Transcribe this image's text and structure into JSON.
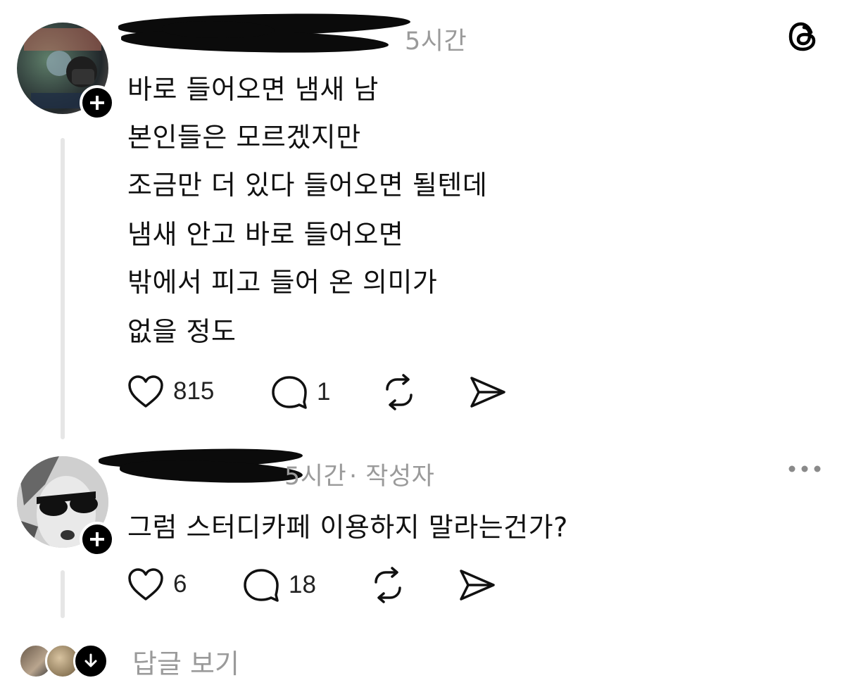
{
  "post": {
    "username": "",
    "time": "5시간",
    "body_lines": [
      "바로 들어오면 냄새 남",
      "본인들은 모르겠지만",
      "조금만 더 있다 들어오면 될텐데",
      "냄새 안고 바로 들어오면",
      "밖에서 피고 들어 온 의미가",
      "없을 정도"
    ],
    "likes": "815",
    "replies": "1"
  },
  "reply": {
    "username": "",
    "time": "5시간",
    "meta_suffix": "· 작성자",
    "text": "그럼 스터디카페 이용하지 말라는건가?",
    "likes": "6",
    "replies": "18"
  },
  "footer": {
    "view_replies": "답글 보기"
  },
  "icons": {
    "app_logo": "threads-logo-icon",
    "like": "heart-icon",
    "comment": "comment-bubble-icon",
    "repost": "repost-icon",
    "share": "send-icon",
    "more": "more-horizontal-icon",
    "follow": "plus-icon",
    "expand": "arrow-down-icon"
  }
}
